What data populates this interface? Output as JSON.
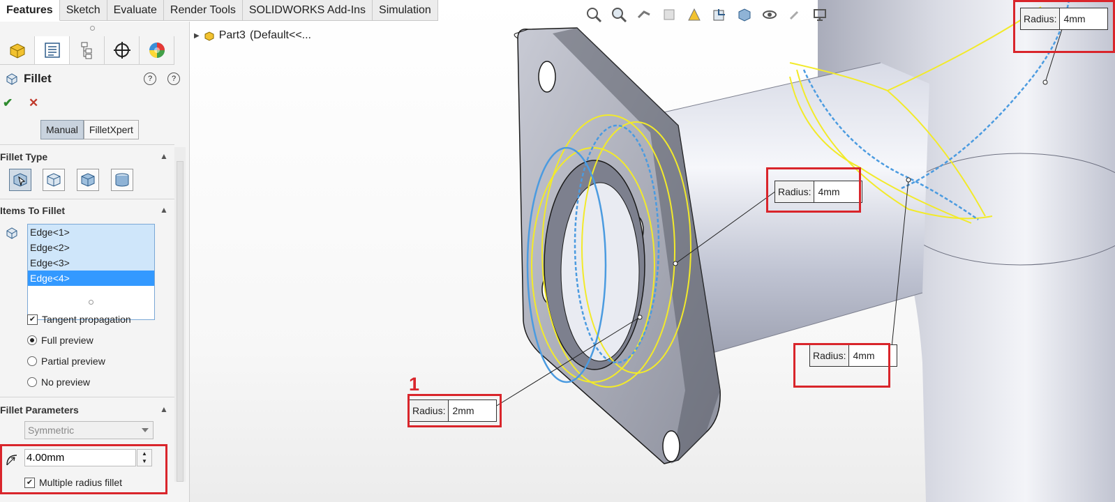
{
  "tabs": [
    "Features",
    "Sketch",
    "Evaluate",
    "Render Tools",
    "SOLIDWORKS Add-Ins",
    "Simulation"
  ],
  "active_tab": "Features",
  "panel_tabs": [
    "featuremanager-icon",
    "propertymanager-icon",
    "configurationmanager-icon",
    "dimxpert-icon",
    "display-manager-icon"
  ],
  "property_manager": {
    "title": "Fillet",
    "modes": [
      "Manual",
      "FilletXpert"
    ],
    "fillet_type": {
      "title": "Fillet Type"
    },
    "items": {
      "title": "Items To Fillet",
      "edges": [
        "Edge<1>",
        "Edge<2>",
        "Edge<3>",
        "Edge<4>"
      ],
      "selected": "Edge<4>"
    },
    "options": {
      "tangent_propagation": "Tangent propagation",
      "full_preview": "Full preview",
      "partial_preview": "Partial preview",
      "no_preview": "No preview"
    },
    "parameters": {
      "title": "Fillet Parameters",
      "method": "Symmetric",
      "radius": "4.00mm",
      "multiple_radius": "Multiple radius fillet"
    }
  },
  "tree": {
    "part": "Part3",
    "config": "(Default<<..."
  },
  "callouts": [
    {
      "label": "Radius:",
      "value": "2mm"
    },
    {
      "label": "Radius:",
      "value": "4mm"
    },
    {
      "label": "Radius:",
      "value": "4mm"
    },
    {
      "label": "Radius:",
      "value": "4mm"
    }
  ],
  "marker": "1",
  "colors": {
    "highlight": "#d9252b",
    "selection": "#3399ff",
    "preview": "#f2ea2a",
    "edge": "#4b9be0"
  }
}
